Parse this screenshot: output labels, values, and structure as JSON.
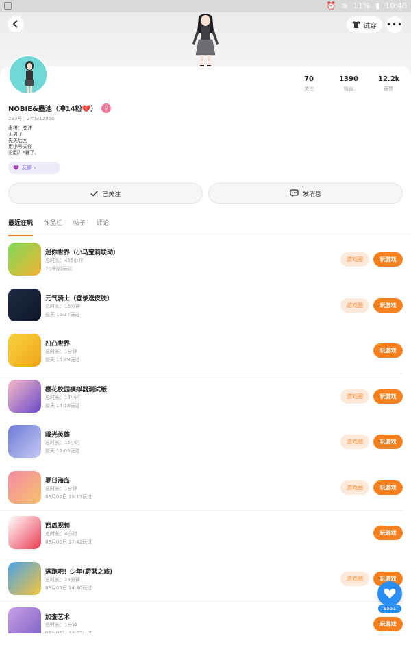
{
  "status_bar": {
    "battery": "11%",
    "time": "10:48"
  },
  "header": {
    "try_on_label": "试穿"
  },
  "profile": {
    "name": "NOBIE&墨池（冲14粉💔）",
    "uid": "233号：240312066",
    "bio_lines": [
      "永拼：关注",
      "无男子",
      "先关后回",
      "用小号关你",
      "没回？*暑了。"
    ],
    "tag_chip": "反聊",
    "stats": [
      {
        "value": "70",
        "label": "关注"
      },
      {
        "value": "1390",
        "label": "粉丝"
      },
      {
        "value": "12.2k",
        "label": "获赞"
      }
    ]
  },
  "actions": {
    "follow": "已关注",
    "message": "发消息"
  },
  "tabs": [
    {
      "label": "最近在玩",
      "active": true
    },
    {
      "label": "作品栏",
      "active": false
    },
    {
      "label": "帖子",
      "active": false
    },
    {
      "label": "评论",
      "active": false
    }
  ],
  "buttons": {
    "circle": "游戏圈",
    "play": "玩游戏"
  },
  "games": [
    {
      "name": "迷你世界（小马宝莉联动）",
      "duration": "总时长：495小时",
      "last": "7小时前玩过",
      "has_circle": true,
      "colors": [
        "#7ed957",
        "#f2b233"
      ]
    },
    {
      "name": "元气骑士（登录送皮肤）",
      "duration": "总时长：16分钟",
      "last": "前天 16:17玩过",
      "has_circle": true,
      "colors": [
        "#1d2a44",
        "#0f1728"
      ]
    },
    {
      "name": "凹凸世界",
      "duration": "总时长：1分钟",
      "last": "前天 15:49玩过",
      "has_circle": false,
      "colors": [
        "#f5d13c",
        "#f2a51c"
      ]
    },
    {
      "name": "樱花校园模拟器测试版",
      "duration": "总时长：14小时",
      "last": "前天 14:18玩过",
      "has_circle": true,
      "colors": [
        "#f7b9c8",
        "#6a4ac7"
      ]
    },
    {
      "name": "曜光英雄",
      "duration": "总时长：15小时",
      "last": "前天 12:06玩过",
      "has_circle": true,
      "colors": [
        "#6b7bd6",
        "#c4c9f2"
      ]
    },
    {
      "name": "夏日海岛",
      "duration": "总时长：1分钟",
      "last": "06月07日 18:11玩过",
      "has_circle": true,
      "colors": [
        "#f28aa4",
        "#f6c16a"
      ]
    },
    {
      "name": "西瓜视频",
      "duration": "总时长：4小时",
      "last": "06月06日 17:42玩过",
      "has_circle": false,
      "colors": [
        "#ffffff",
        "#e83a4f"
      ]
    },
    {
      "name": "逃跑吧！少年(蔚蓝之旅)",
      "duration": "总时长：28分钟",
      "last": "06月05日 14:40玩过",
      "has_circle": true,
      "colors": [
        "#4aa3e8",
        "#f4c43a"
      ]
    },
    {
      "name": "加查艺术",
      "duration": "总时长：1分钟",
      "last": "06月05日 14:22玩过",
      "has_circle": false,
      "colors": [
        "#c9a0e6",
        "#7b5fc4"
      ]
    }
  ],
  "like_fab": {
    "count": "9551"
  },
  "colors": {
    "accent": "#f7801e",
    "fab": "#2b8ef2",
    "avatar_bg": "#6fd7d6"
  }
}
